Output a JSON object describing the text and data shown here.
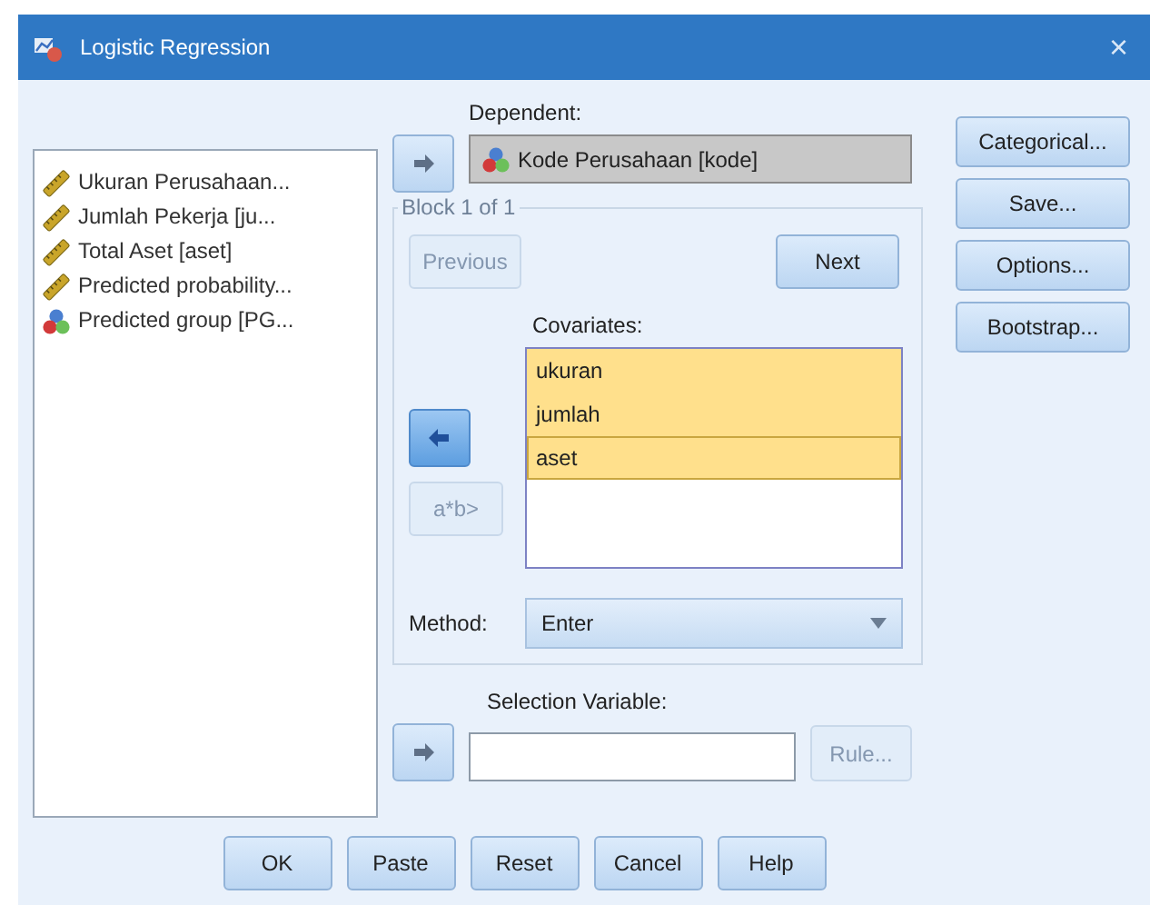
{
  "window": {
    "title": "Logistic Regression",
    "close": "×"
  },
  "variables": [
    {
      "label": "Ukuran Perusahaan...",
      "kind": "scale"
    },
    {
      "label": "Jumlah Pekerja [ju...",
      "kind": "scale"
    },
    {
      "label": "Total Aset [aset]",
      "kind": "scale"
    },
    {
      "label": "Predicted probability...",
      "kind": "scale"
    },
    {
      "label": "Predicted group [PG...",
      "kind": "nominal"
    }
  ],
  "dependent": {
    "label": "Dependent:",
    "arrow": {
      "kind": "right"
    },
    "value": "Kode Perusahaan [kode]",
    "kind": "nominal"
  },
  "block": {
    "title": "Block 1 of 1",
    "previous": {
      "label": "Previous",
      "disabled": true
    },
    "next": {
      "label": "Next",
      "disabled": false
    },
    "covariates_label": "Covariates:",
    "arrow": {
      "kind": "left"
    },
    "covariates": [
      {
        "label": "ukuran",
        "selected": true,
        "focused": false
      },
      {
        "label": "jumlah",
        "selected": true,
        "focused": false
      },
      {
        "label": "aset",
        "selected": true,
        "focused": true
      }
    ],
    "interaction": {
      "label": "a*b>",
      "disabled": true
    },
    "method": {
      "label": "Method:",
      "value": "Enter"
    }
  },
  "selection": {
    "label": "Selection Variable:",
    "arrow": {
      "kind": "right"
    },
    "rule": {
      "label": "Rule...",
      "disabled": true
    }
  },
  "side_buttons": [
    "Categorical...",
    "Save...",
    "Options...",
    "Bootstrap..."
  ],
  "buttons": [
    "OK",
    "Paste",
    "Reset",
    "Cancel",
    "Help"
  ]
}
